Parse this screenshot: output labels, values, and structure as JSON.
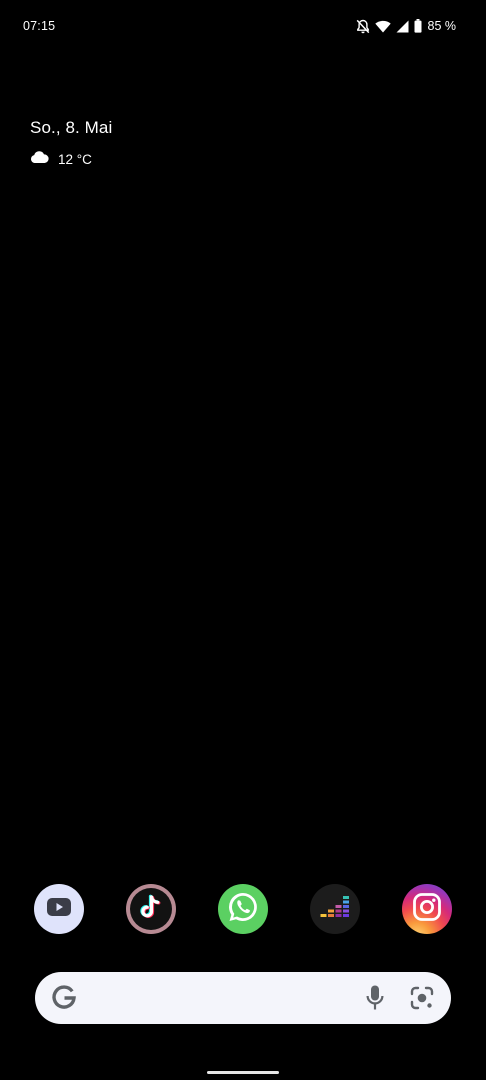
{
  "status_bar": {
    "time": "07:15",
    "icons": [
      "notifications-off-icon",
      "wifi-icon",
      "cell-signal-icon",
      "battery-icon"
    ],
    "battery_level": "85 %"
  },
  "glance": {
    "date": "So., 8. Mai",
    "weather_icon": "cloud-icon",
    "temperature": "12 °C"
  },
  "dock": {
    "apps": [
      {
        "name": "YouTube",
        "icon": "youtube-icon",
        "color": "#dfe3fb"
      },
      {
        "name": "TikTok",
        "icon": "tiktok-icon",
        "color": "#b78a93"
      },
      {
        "name": "WhatsApp",
        "icon": "whatsapp-icon",
        "color": "#5bd062"
      },
      {
        "name": "Deezer",
        "icon": "deezer-icon",
        "color": "#1c1c1c"
      },
      {
        "name": "Instagram",
        "icon": "instagram-icon",
        "color": "#d52a7a"
      }
    ]
  },
  "search_bar": {
    "left_icon": "google-g-icon",
    "right_icons": [
      "microphone-icon",
      "google-lens-icon"
    ],
    "background": "#f4f5fb"
  },
  "colors": {
    "background": "#000000",
    "text": "#ffffff"
  }
}
